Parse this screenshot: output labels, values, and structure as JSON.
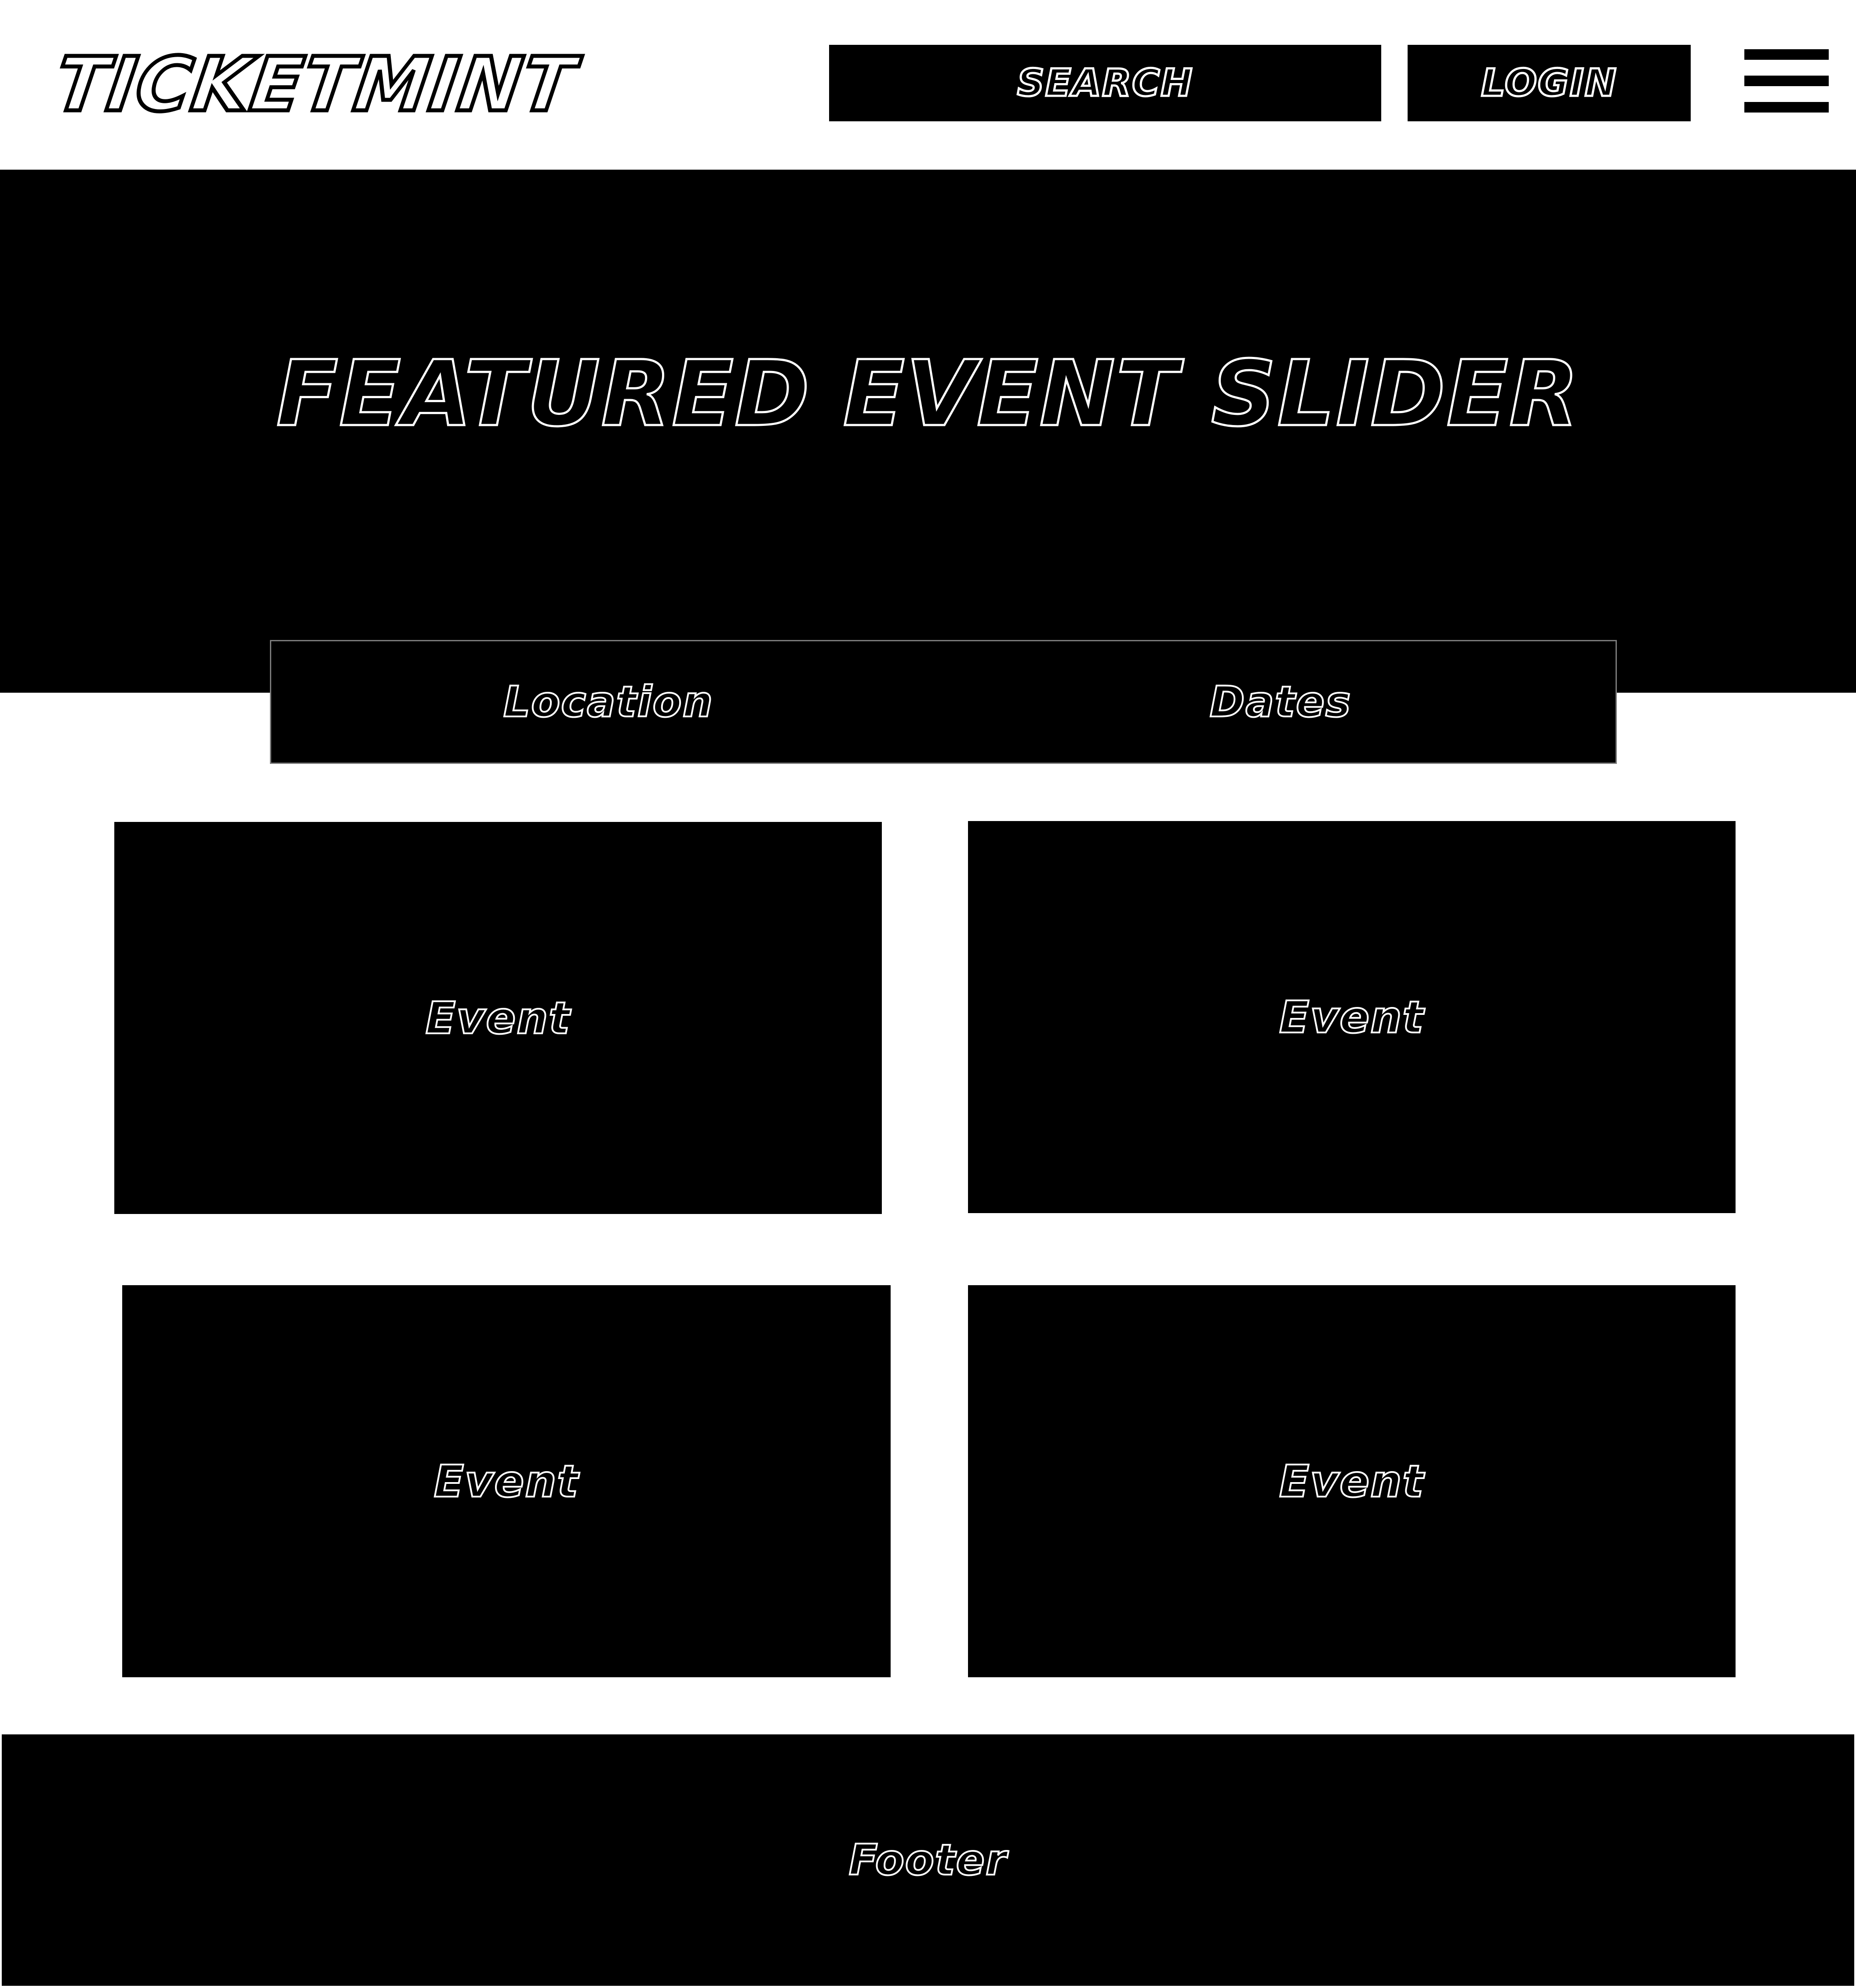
{
  "header": {
    "logo_text": "TICKETMINT",
    "search_label": "SEARCH",
    "login_label": "LOGIN",
    "menu_icon": "hamburger-menu-icon"
  },
  "hero": {
    "title": "FEATURED EVENT SLIDER"
  },
  "filters": {
    "location_label": "Location",
    "dates_label": "Dates"
  },
  "events": [
    {
      "label": "Event"
    },
    {
      "label": "Event"
    },
    {
      "label": "Event"
    },
    {
      "label": "Event"
    }
  ],
  "footer": {
    "label": "Footer"
  },
  "colors": {
    "background": "#ffffff",
    "block": "#000000",
    "text_outline": "#ffffff"
  }
}
